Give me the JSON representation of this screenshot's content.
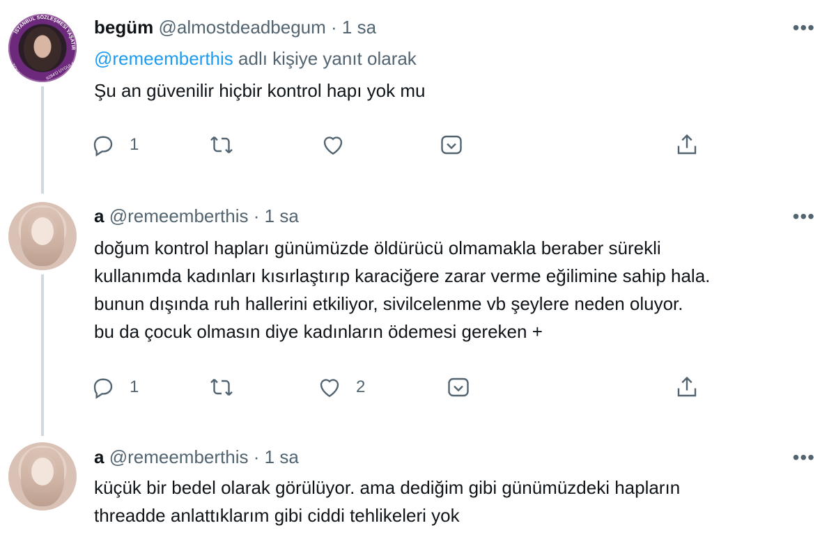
{
  "tweets": [
    {
      "name": "begüm",
      "handle": "@almostdeadbegum",
      "sep": "·",
      "time": "1 sa",
      "reply_mention": "@remeemberthis",
      "reply_suffix": " adlı kişiye yanıt olarak",
      "lines": [
        "Şu an güvenilir hiçbir kontrol hapı yok mu"
      ],
      "reply_count": "1",
      "retweet_count": "",
      "like_count": "",
      "more_label": "•••"
    },
    {
      "name": "a",
      "handle": "@remeemberthis",
      "sep": "·",
      "time": "1 sa",
      "lines": [
        "doğum kontrol hapları günümüzde öldürücü olmamakla beraber sürekli",
        "kullanımda kadınları kısırlaştırıp karaciğere zarar verme eğilimine sahip hala.",
        "bunun dışında ruh hallerini etkiliyor, sivilcelenme vb şeylere neden oluyor.",
        "bu da çocuk olmasın diye kadınların ödemesi gereken +"
      ],
      "reply_count": "1",
      "retweet_count": "",
      "like_count": "2",
      "more_label": "•••"
    },
    {
      "name": "a",
      "handle": "@remeemberthis",
      "sep": "·",
      "time": "1 sa",
      "lines": [
        "küçük bir bedel olarak görülüyor. ama dediğim gibi günümüzdeki hapların",
        "threadde anlattıklarım gibi ciddi tehlikeleri yok"
      ],
      "more_label": "•••"
    }
  ],
  "avatar_badge_text": [
    "İSTANBUL SÖZLEŞMESİ YAŞATIR",
    "TCK-103",
    "6284'Ü UYGULA"
  ],
  "colors": {
    "link": "#1d9bf0",
    "muted": "#536471",
    "thread_line": "#cfd9de",
    "text": "#0f1419"
  },
  "icons": [
    "reply-icon",
    "retweet-icon",
    "like-icon",
    "revue-icon",
    "share-icon",
    "more-icon"
  ]
}
